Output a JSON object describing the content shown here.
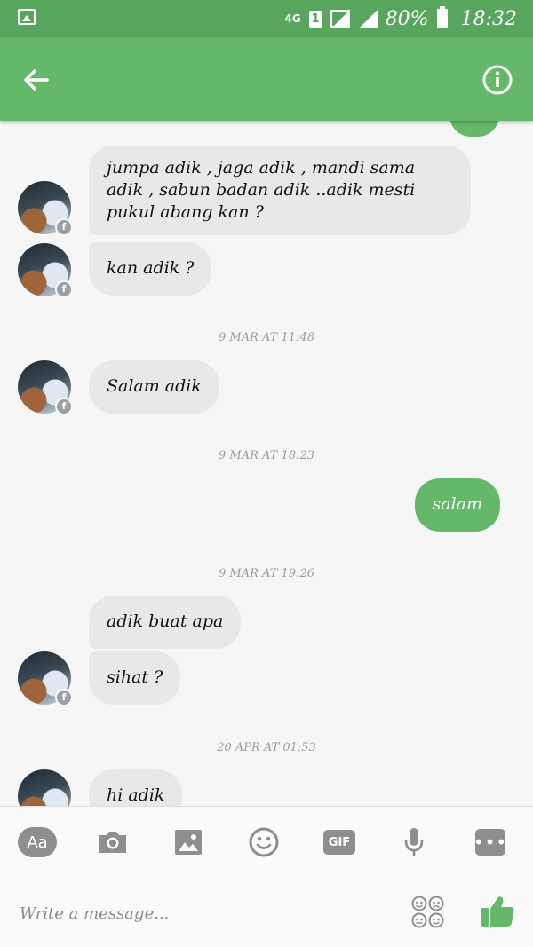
{
  "status_bar": {
    "network": "4G",
    "sim": "1",
    "battery": "80%",
    "time": "18:32"
  },
  "app_bar": {
    "back_icon": "arrow-left-icon",
    "info_icon": "info-icon"
  },
  "messages": [
    {
      "side": "in",
      "text": "jumpa adik , jaga adik , mandi sama adik , sabun badan adik ..adik mesti pukul abang kan ?"
    },
    {
      "side": "in",
      "text": "kan adik ?"
    },
    {
      "type": "timestamp",
      "text": "9 MAR AT 11:48"
    },
    {
      "side": "in",
      "text": "Salam adik"
    },
    {
      "type": "timestamp",
      "text": "9 MAR AT 18:23"
    },
    {
      "side": "out",
      "text": "salam"
    },
    {
      "type": "timestamp",
      "text": "9 MAR AT 19:26"
    },
    {
      "side": "in",
      "text": "adik buat apa"
    },
    {
      "side": "in",
      "text": "sihat ?"
    },
    {
      "type": "timestamp",
      "text": "20 APR AT 01:53"
    },
    {
      "side": "in",
      "text": "hi adik"
    }
  ],
  "toolbar": {
    "text_label": "Aa",
    "gif_label": "GIF",
    "icons": [
      "text-icon",
      "camera-icon",
      "image-icon",
      "emoji-icon",
      "gif-icon",
      "microphone-icon",
      "more-icon"
    ]
  },
  "composer": {
    "placeholder": "Write a message...",
    "like_icon": "thumbs-up-icon"
  },
  "colors": {
    "accent": "#65b869",
    "status_bar": "#58a55d",
    "incoming_bubble": "#e8e8e8"
  }
}
